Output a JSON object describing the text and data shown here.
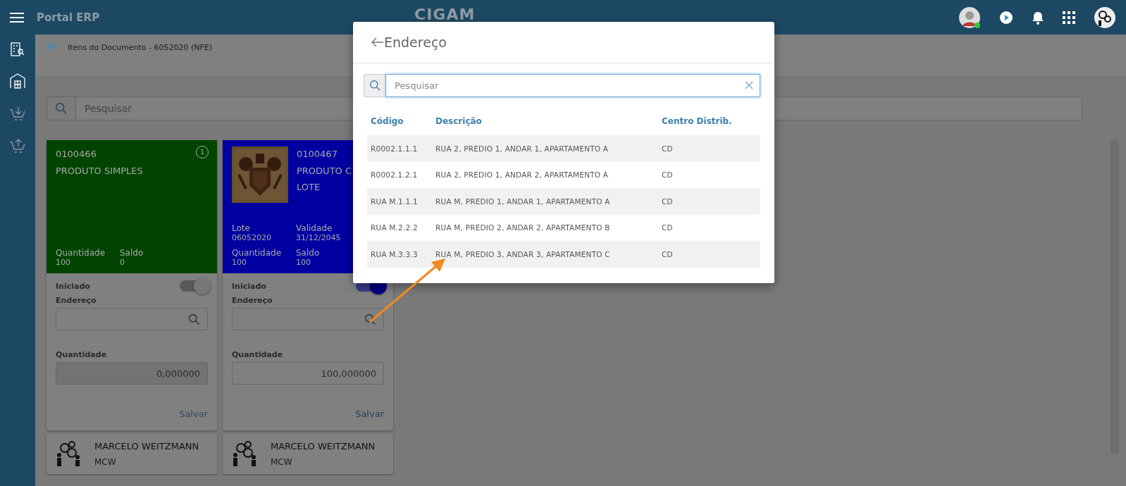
{
  "app": {
    "title": "Portal ERP",
    "logo": "CIGAM"
  },
  "page": {
    "title": "Itens do Documento - 6052020 (NFE)",
    "search": {
      "placeholder": "Pesquisar"
    }
  },
  "items": [
    {
      "code": "0100466",
      "name_lines": [
        "PRODUTO SIMPLES"
      ],
      "color": "#004400",
      "badge": "1",
      "has_image": false,
      "totals": [
        {
          "label": "Quantidade",
          "value": "100"
        },
        {
          "label": "Saldo",
          "value": "0"
        }
      ],
      "toggle_label": "Iniciado",
      "on": true,
      "disabled": true,
      "address_label": "Endereço",
      "quantity_label": "Quantidade",
      "quantity": "0,000000",
      "save": "Salvar",
      "user": {
        "name": "MARCELO WEITZMANN",
        "initials": "MCW"
      }
    },
    {
      "code": "0100467",
      "name_lines": [
        "PRODUTO C",
        "LOTE"
      ],
      "color": "#0000a0",
      "has_image": true,
      "info": [
        {
          "label": "Lote",
          "value": "06052020"
        },
        {
          "label": "Validade",
          "value": "31/12/2045"
        }
      ],
      "totals": [
        {
          "label": "Quantidade",
          "value": "100"
        },
        {
          "label": "Saldo",
          "value": "100"
        }
      ],
      "toggle_label": "Iniciado",
      "on": true,
      "disabled": false,
      "address_label": "Endereço",
      "quantity_label": "Quantidade",
      "quantity": "100,000000",
      "save": "Salvar",
      "user": {
        "name": "MARCELO WEITZMANN",
        "initials": "MCW"
      }
    }
  ],
  "dialog": {
    "title": "Endereço",
    "search": {
      "placeholder": "Pesquisar"
    },
    "columns": [
      "Código",
      "Descrição",
      "Centro Distrib."
    ],
    "rows": [
      [
        "R0002.1.1.1",
        "RUA 2, PREDIO 1, ANDAR 1, APARTAMENTO A",
        "CD"
      ],
      [
        "R0002.1.2.1",
        "RUA 2, PREDIO 1, ANDAR 2, APARTAMENTO A",
        "CD"
      ],
      [
        "RUA M.1.1.1",
        "RUA M, PREDIO 1, ANDAR 1, APARTAMENTO A",
        "CD"
      ],
      [
        "RUA M.2.2.2",
        "RUA M, PREDIO 2, ANDAR 2, APARTAMENTO B",
        "CD"
      ],
      [
        "RUA M.3.3.3",
        "RUA M, PREDIO 3, ANDAR 3, APARTAMENTO C",
        "CD"
      ]
    ]
  }
}
